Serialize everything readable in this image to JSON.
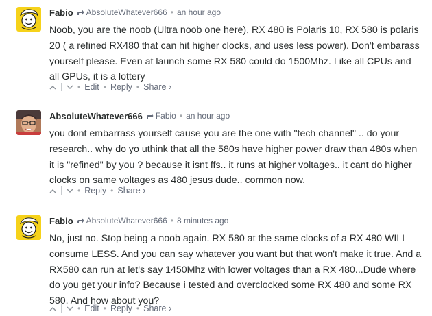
{
  "comments": [
    {
      "author": "Fabio",
      "reply_to": "AbsoluteWhatever666",
      "time": "an hour ago",
      "avatar_icon": "yellow-cartoon-face-avatar",
      "body": "Noob, you are the noob (Ultra noob one here), RX 480 is Polaris 10, RX 580 is polaris 20 ( a refined RX480 that can hit higher clocks, and uses less power). Don't embarass yourself please. Even at launch some RX 580 could do 1500Mhz. Like all CPUs and all GPUs, it is a lottery",
      "actions": {
        "edit": "Edit",
        "reply": "Reply",
        "share": "Share ›"
      }
    },
    {
      "author": "AbsoluteWhatever666",
      "reply_to": "Fabio",
      "time": "an hour ago",
      "avatar_icon": "photo-avatar",
      "body": "you dont embarrass yourself cause you are the one with \"tech channel\" .. do your research.. why do yo uthink that all the 580s have higher power draw than 480s when it is \"refined\" by you ? because it isnt ffs.. it runs at higher voltages.. it cant do higher clocks on same voltages as 480 jesus dude.. common now.",
      "actions": {
        "reply": "Reply",
        "share": "Share ›"
      }
    },
    {
      "author": "Fabio",
      "reply_to": "AbsoluteWhatever666",
      "time": "8 minutes ago",
      "avatar_icon": "yellow-cartoon-face-avatar",
      "body": "No, just no. Stop being a noob again. RX 580 at the same clocks of a RX 480 WILL consume LESS. And you can say whatever you want but that won't make it true. And a RX580 can run at let's say 1450Mhz with lower voltages than a RX 480...Dude where do you get your info? Because i tested and overclocked some RX 480 and some RX 580. And how about you?",
      "actions": {
        "edit": "Edit",
        "reply": "Reply",
        "share": "Share ›"
      }
    }
  ],
  "separator_dot": "•",
  "colors": {
    "text": "#2a2e2e",
    "muted": "#656c7a",
    "avatar_yellow": "#f6d21a"
  }
}
